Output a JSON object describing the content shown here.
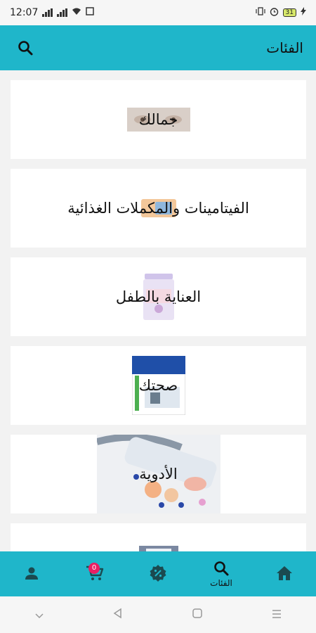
{
  "status_bar": {
    "time": "12:07",
    "battery": "31"
  },
  "header": {
    "title": "الفئات"
  },
  "categories": [
    {
      "name": "جمالك"
    },
    {
      "name": "الفيتامينات والمكملات الغذائية"
    },
    {
      "name": "العناية بالطفل"
    },
    {
      "name": "صحتك"
    },
    {
      "name": "الأدوية"
    },
    {
      "name": ""
    }
  ],
  "bottom_nav": {
    "home": {
      "label": ""
    },
    "categories": {
      "label": "الفئات"
    },
    "offers": {
      "label": ""
    },
    "cart": {
      "label": "",
      "badge": "0"
    },
    "profile": {
      "label": ""
    }
  },
  "colors": {
    "primary": "#1fb6ca",
    "badge": "#ea1e63"
  }
}
